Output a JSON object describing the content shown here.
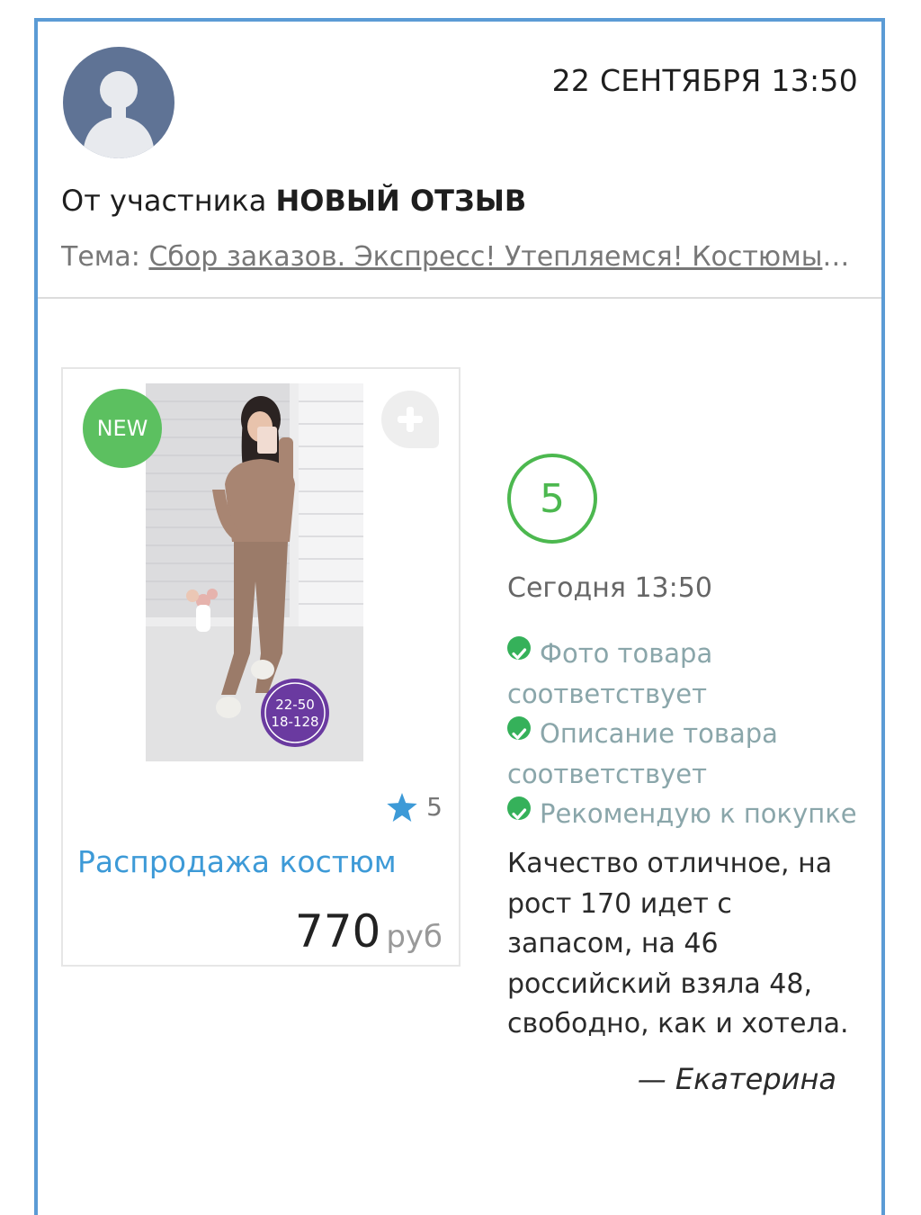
{
  "header": {
    "date": "22 СЕНТЯБРЯ 13:50",
    "from_prefix": "От участника",
    "from_bold": "НОВЫЙ ОТЗЫВ",
    "topic_label": "Тема:",
    "topic_link": "Сбор заказов. Экспресс! Утепляемся! Костюмы на осень и зиму"
  },
  "product": {
    "badge": "NEW",
    "photo_size_label_1": "22-50",
    "photo_size_label_2": "18-128",
    "rating": "5",
    "name": "Распродажа костюм",
    "price": "770",
    "currency": "руб"
  },
  "review": {
    "score": "5",
    "time": "Сегодня 13:50",
    "checks": [
      "Фото товара соответствует",
      "Описание товара соответствует",
      "Рекомендую к покупке"
    ],
    "text": "Качество отличное, на рост 170 идет с запасом, на 46 российский взяла 48, свободно, как и хотела.",
    "author": "— Екатерина"
  },
  "colors": {
    "frame_border": "#5b9bd5",
    "accent_blue": "#3d9ad7",
    "accent_green": "#4cb84f",
    "avatar_bg": "#5f7395"
  },
  "icons": [
    "avatar-placeholder-icon",
    "plus-icon",
    "star-icon",
    "check-circle-icon"
  ]
}
